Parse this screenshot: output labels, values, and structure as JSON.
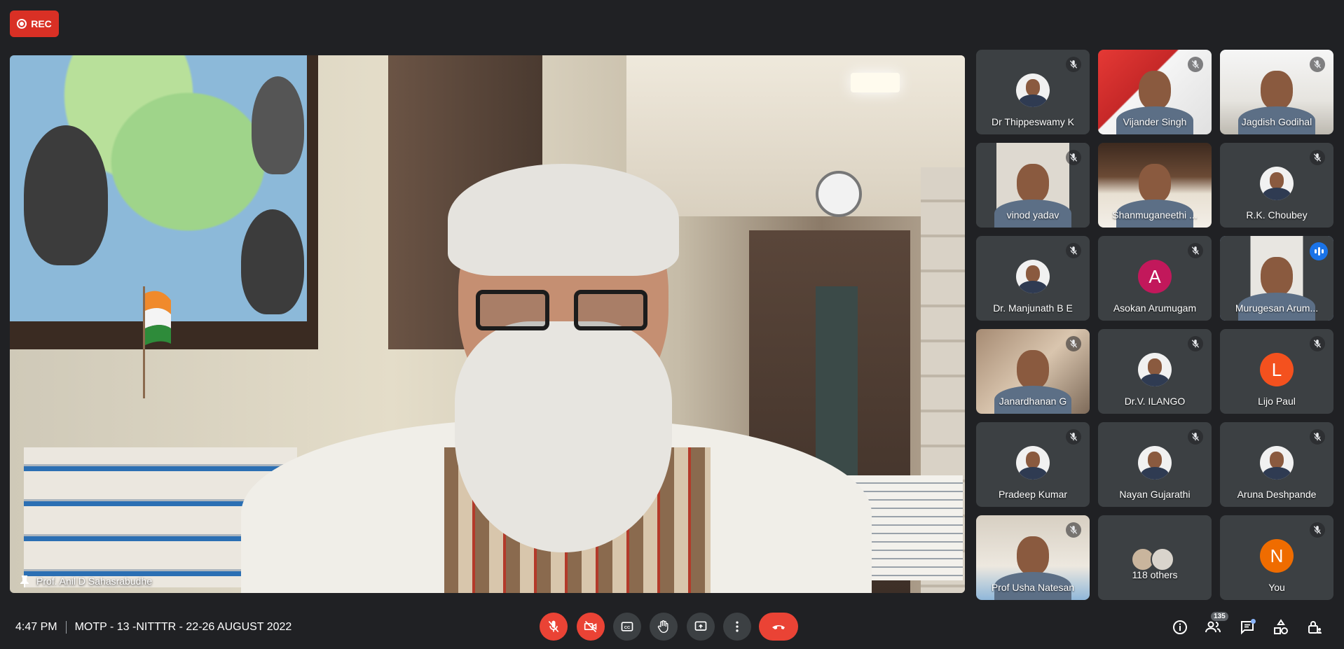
{
  "recording": {
    "label": "REC",
    "color": "#d93025"
  },
  "main_speaker": {
    "name": "Prof. Anil D Sahasrabudhe"
  },
  "participants": [
    {
      "name": "Dr Thippeswamy K",
      "type": "photo",
      "muted": true
    },
    {
      "name": "Vijander Singh",
      "type": "video",
      "muted": true
    },
    {
      "name": "Jagdish Godihal",
      "type": "video",
      "muted": true
    },
    {
      "name": "vinod yadav",
      "type": "video",
      "muted": true
    },
    {
      "name": "Shanmuganeethi ...",
      "type": "video",
      "muted": false
    },
    {
      "name": "R.K. Choubey",
      "type": "photo",
      "muted": true
    },
    {
      "name": "Dr. Manjunath B E",
      "type": "photo",
      "muted": true
    },
    {
      "name": "Asokan Arumugam",
      "type": "letter",
      "letter": "A",
      "avatar_color": "#c2185b",
      "muted": true
    },
    {
      "name": "Murugesan Arum...",
      "type": "video",
      "speaking": true
    },
    {
      "name": "Janardhanan G",
      "type": "video",
      "muted": true
    },
    {
      "name": "Dr.V. ILANGO",
      "type": "photo",
      "muted": true
    },
    {
      "name": "Lijo Paul",
      "type": "letter",
      "letter": "L",
      "avatar_color": "#f4511e",
      "muted": true
    },
    {
      "name": "Pradeep Kumar",
      "type": "photo",
      "muted": true
    },
    {
      "name": "Nayan Gujarathi",
      "type": "photo",
      "muted": true
    },
    {
      "name": "Aruna Deshpande",
      "type": "photo",
      "muted": true
    },
    {
      "name": "Prof Usha Natesan",
      "type": "video",
      "muted": true
    },
    {
      "name": "118 others",
      "type": "others"
    },
    {
      "name": "You",
      "type": "letter",
      "letter": "N",
      "avatar_color": "#ef6c00",
      "muted": true
    }
  ],
  "bottom_bar": {
    "time": "4:47 PM",
    "meeting_title": "MOTP - 13 -NITTTR - 22-26 AUGUST 2022",
    "people_count": "135"
  },
  "colors": {
    "background": "#202124",
    "tile": "#3c4043",
    "danger": "#ea4335",
    "active_outline": "#8ab4f8"
  }
}
